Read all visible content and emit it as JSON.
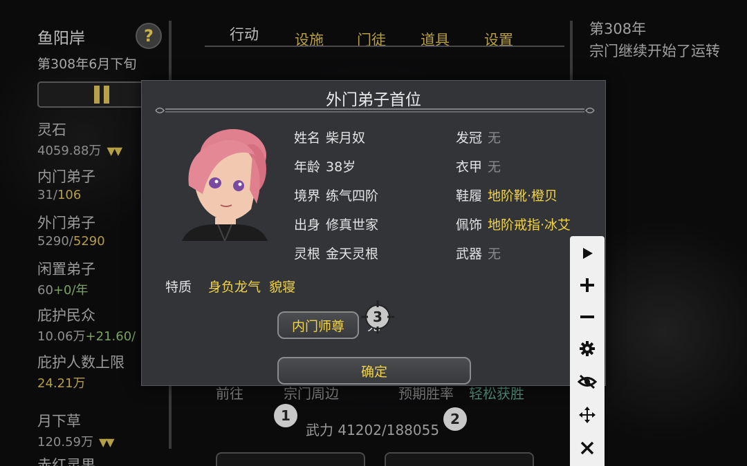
{
  "sidebar": {
    "location_name": "鱼阳岸",
    "help_glyph": "?",
    "date": "第308年6月下旬",
    "resources": [
      {
        "label": "灵石",
        "value": "4059.88万",
        "extra": "",
        "arrows": "▼▼"
      },
      {
        "label": "内门弟子",
        "value": "31/",
        "extra": "106",
        "arrows": ""
      },
      {
        "label": "外门弟子",
        "value": "5290/",
        "extra": "5290",
        "arrows": ""
      },
      {
        "label": "闲置弟子",
        "value": "60",
        "extra": "+0/年",
        "arrows": ""
      },
      {
        "label": "庇护民众",
        "value": "10.06万",
        "extra": "+21.60/",
        "arrows": ""
      },
      {
        "label": "庇护人数上限",
        "value": "",
        "extra": "24.21万",
        "arrows": ""
      },
      {
        "label": "月下草",
        "value": "120.59万",
        "extra": "",
        "arrows": "▼▼"
      },
      {
        "label": "赤红灵果",
        "value": "",
        "extra": "",
        "arrows": ""
      }
    ]
  },
  "tabs": [
    "行动",
    "设施",
    "门徒",
    "道具",
    "设置"
  ],
  "log": {
    "year": "第308年",
    "text": "宗门继续开始了运转"
  },
  "background": {
    "goto_label": "前往",
    "area_label": "宗门周边",
    "win_rate_label": "预期胜率",
    "win_rate_value": "轻松获胜",
    "force": "武力 41202/188055",
    "marker_1": "1",
    "marker_2": "2"
  },
  "modal": {
    "title": "外门弟子首位",
    "fields_left": [
      {
        "key": "姓名",
        "value": "柴月奴"
      },
      {
        "key": "年龄",
        "value": "38岁"
      },
      {
        "key": "境界",
        "value": "练气四阶"
      },
      {
        "key": "出身",
        "value": "修真世家"
      },
      {
        "key": "灵根",
        "value": "金天灵根"
      }
    ],
    "fields_right": [
      {
        "key": "发冠",
        "value": "无",
        "style": "none"
      },
      {
        "key": "衣甲",
        "value": "无",
        "style": "none"
      },
      {
        "key": "鞋履",
        "value": "地阶靴·橙贝",
        "style": "gold"
      },
      {
        "key": "佩饰",
        "value": "地阶戒指·冰艾",
        "style": "gold"
      },
      {
        "key": "武器",
        "value": "无",
        "style": "none"
      }
    ],
    "trait_label": "特质",
    "traits": "身负龙气  貌寝",
    "master_button": "内门师尊",
    "master_value": "无",
    "confirm_button": "确定",
    "marker_3": "3"
  },
  "toolbar": [
    "play-icon",
    "plus-icon",
    "minus-icon",
    "gear-icon",
    "eye-off-icon",
    "move-icon",
    "close-icon"
  ]
}
